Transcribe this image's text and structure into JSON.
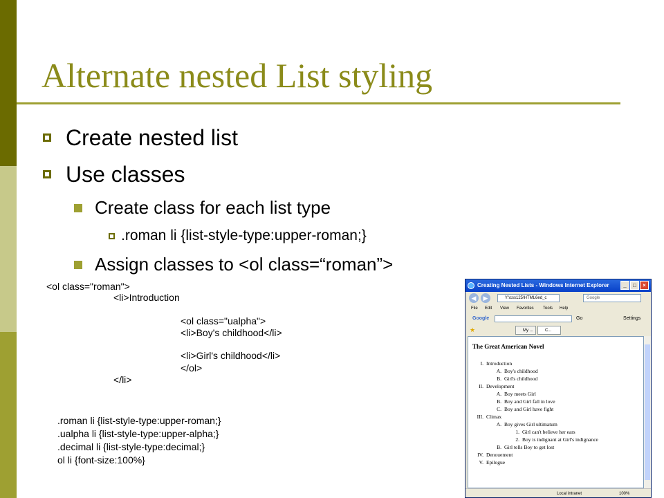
{
  "slide": {
    "title": "Alternate nested List styling",
    "bullets": [
      "Create nested list",
      "Use classes"
    ],
    "sub_bullets": [
      "Create class for each list type",
      "Assign classes to <ol class=“roman”>"
    ],
    "sub_sub_bullet": ".roman li {list-style-type:upper-roman;}"
  },
  "code_html": {
    "line1": "<ol class=\"roman\">",
    "line2": "<li>Introduction",
    "line3": "<ol class=\"ualpha\">",
    "line4": "<li>Boy's childhood</li>",
    "line5": "<li>Girl's childhood</li>",
    "line6": "</ol>",
    "line7": "</li>"
  },
  "code_css": [
    ".roman li {list-style-type:upper-roman;}",
    ".ualpha li {list-style-type:upper-alpha;}",
    ".decimal li {list-style-type:decimal;}",
    "ol li {font-size:100%}"
  ],
  "browser": {
    "window_title": "Creating Nested Lists - Windows Internet Explorer",
    "address": "Y:\\css125\\HTML6ed_c",
    "search_placeholder": "Google",
    "menu": [
      "File",
      "Edit",
      "View",
      "Favorites",
      "Tools",
      "Help"
    ],
    "google_label": "Google",
    "go_label": "Go",
    "settings_label": "Settings",
    "tab1": "My ...",
    "tab2": "C...",
    "page_heading": "The Great American Novel",
    "items": [
      {
        "marker": "I.",
        "text": "Introduction"
      },
      {
        "marker": "A.",
        "text": "Boy's childhood"
      },
      {
        "marker": "B.",
        "text": "Girl's childhood"
      },
      {
        "marker": "II.",
        "text": "Development"
      },
      {
        "marker": "A.",
        "text": "Boy meets Girl"
      },
      {
        "marker": "B.",
        "text": "Boy and Girl fall in love"
      },
      {
        "marker": "C.",
        "text": "Boy and Girl have fight"
      },
      {
        "marker": "III.",
        "text": "Climax"
      },
      {
        "marker": "A.",
        "text": "Boy gives Girl ultimatum"
      },
      {
        "marker": "1.",
        "text": "Girl can't believe her ears"
      },
      {
        "marker": "2.",
        "text": "Boy is indignant at Girl's indignance"
      },
      {
        "marker": "B.",
        "text": "Girl tells Boy to get lost"
      },
      {
        "marker": "IV.",
        "text": "Denouement"
      },
      {
        "marker": "V.",
        "text": "Epilogue"
      }
    ],
    "status_zone": "Local intranet",
    "zoom": "100%"
  },
  "colors": {
    "accent_dark": "#6b6b00",
    "accent_light": "#c7c98a",
    "accent_mid": "#9ea032",
    "title": "#8b8b1a"
  }
}
